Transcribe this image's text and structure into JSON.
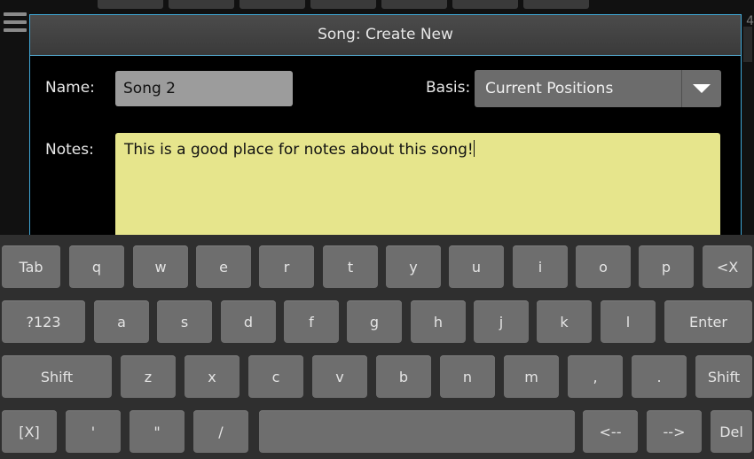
{
  "dialog": {
    "title": "Song: Create New",
    "name_label": "Name:",
    "name_value": "Song 2",
    "basis_label": "Basis:",
    "basis_value": "Current Positions",
    "notes_label": "Notes:",
    "notes_value": "This is a good place for notes about this song!"
  },
  "background": {
    "corner_digit": "4"
  },
  "colors": {
    "dialog_border": "#3fa7d6",
    "notes_bg": "#e6e58c",
    "key_bg": "#6e6e6e"
  },
  "keyboard": {
    "row1": [
      "Tab",
      "q",
      "w",
      "e",
      "r",
      "t",
      "y",
      "u",
      "i",
      "o",
      "p",
      "<X"
    ],
    "row2": [
      "?123",
      "a",
      "s",
      "d",
      "f",
      "g",
      "h",
      "j",
      "k",
      "l",
      "Enter"
    ],
    "row3": [
      "Shift",
      "z",
      "x",
      "c",
      "v",
      "b",
      "n",
      "m",
      ",",
      ".",
      "Shift"
    ],
    "row4": [
      "[X]",
      "'",
      "\"",
      "/",
      "",
      "<--",
      "-->",
      "Del"
    ]
  }
}
